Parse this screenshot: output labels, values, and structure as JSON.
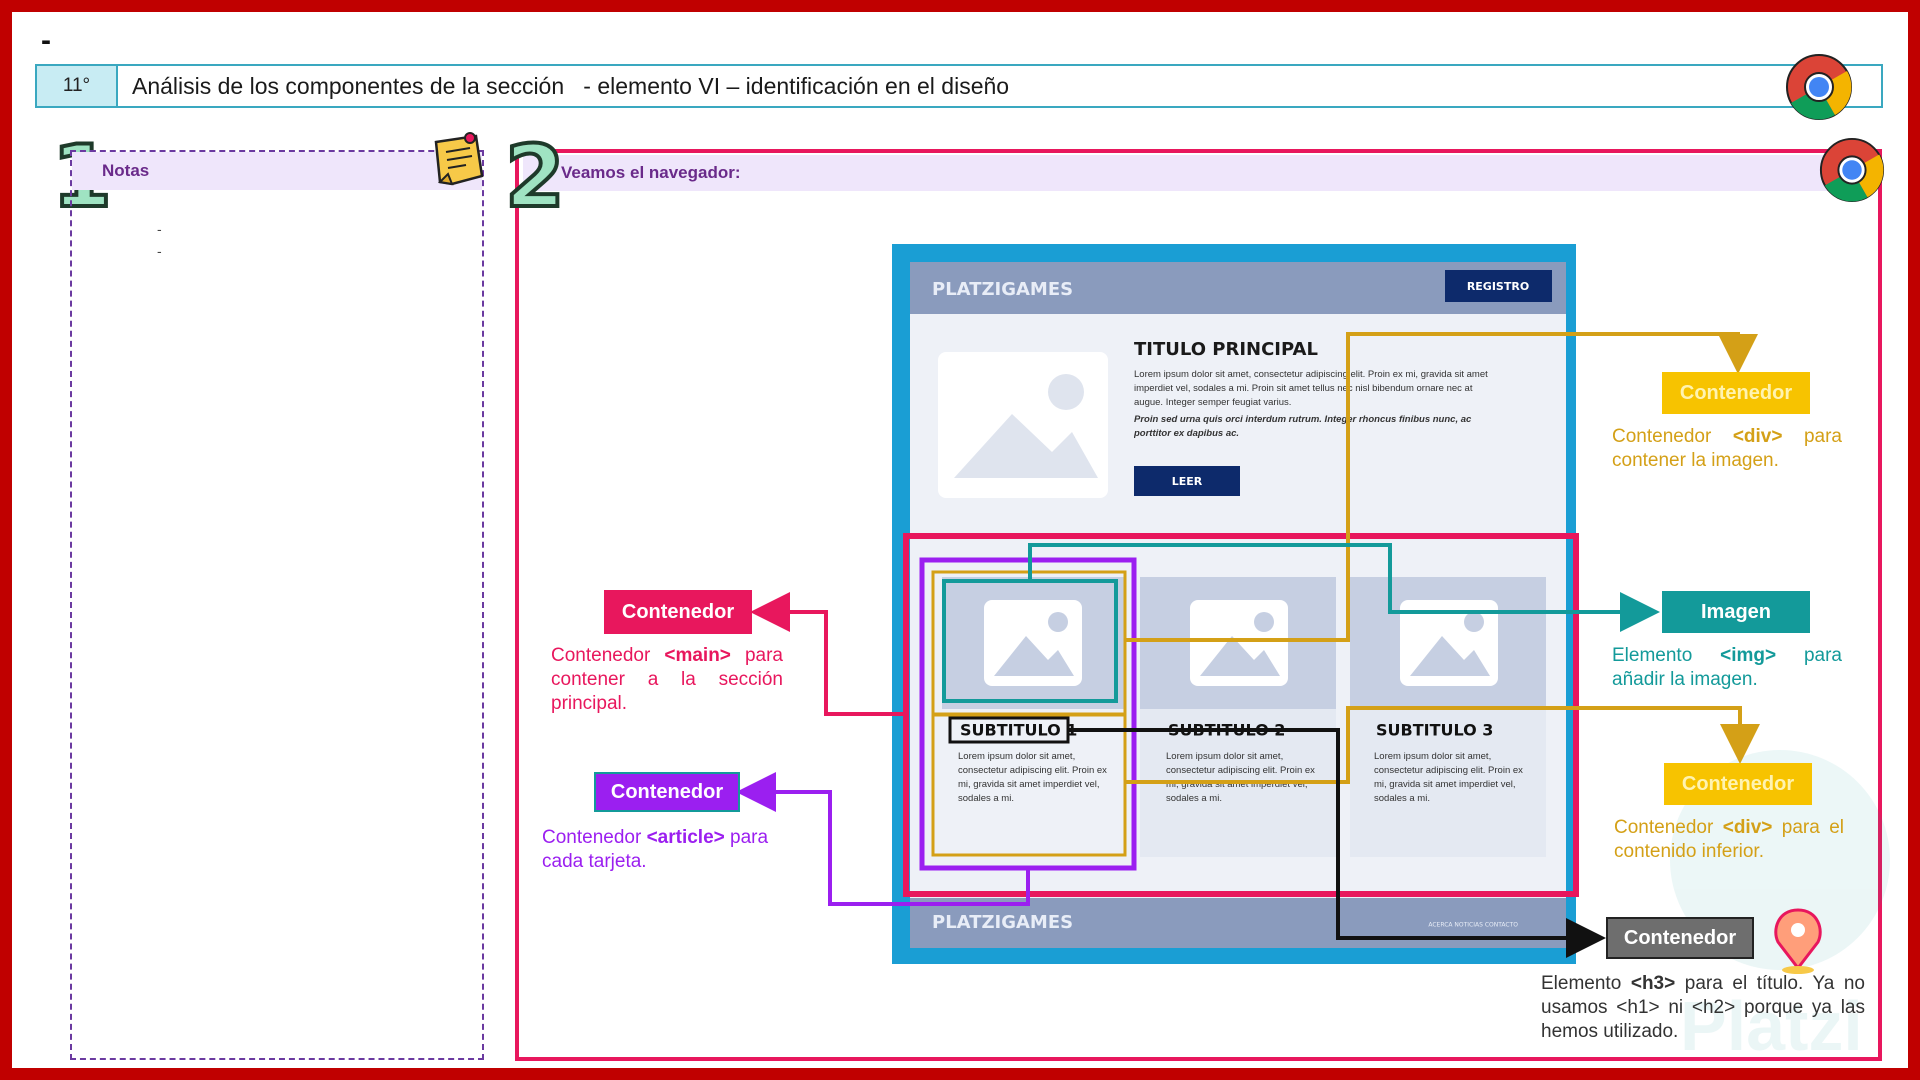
{
  "page": {
    "top_dash": "-",
    "slide_number": "11°",
    "slide_title": "Análisis de los componentes de la sección   - elemento VI – identificación en el diseño"
  },
  "notes_panel": {
    "number": "1",
    "title": "Notas",
    "items": [
      "-",
      "-"
    ]
  },
  "browser_panel": {
    "number": "2",
    "title": "Veamos el navegador:"
  },
  "mockup": {
    "brand": "PLATZIGAMES",
    "register_button": "REGISTRO",
    "main_title": "TITULO PRINCIPAL",
    "paragraph": "Lorem ipsum dolor sit amet, consectetur adipiscing elit. Proin ex mi, gravida sit amet imperdiet vel, sodales a mi. Proin sit amet tellus nec nisl bibendum ornare nec at augue. Integer semper feugiat varius.",
    "paragraph_italic": "Proin sed urna quis orci interdum rutrum. Integer rhoncus finibus nunc, ac porttitor ex dapibus ac.",
    "read_button": "LEER",
    "cards": [
      {
        "subtitle": "SUBTITULO 1",
        "text": "Lorem ipsum dolor sit amet, consectetur adipiscing elit. Proin ex mi, gravida sit amet imperdiet vel, sodales a mi."
      },
      {
        "subtitle": "SUBTITULO 2",
        "text": "Lorem ipsum dolor sit amet, consectetur adipiscing elit. Proin ex mi, gravida sit amet imperdiet vel, sodales a mi."
      },
      {
        "subtitle": "SUBTITULO 3",
        "text": "Lorem ipsum dolor sit amet, consectetur adipiscing elit. Proin ex mi, gravida sit amet imperdiet vel, sodales a mi."
      }
    ],
    "footer_brand": "PLATZIGAMES",
    "footer_links": "ACERCA  NOTICIAS  CONTACTO"
  },
  "callouts": {
    "main": {
      "label": "Contenedor",
      "desc_pre": "Contenedor ",
      "tag": "<main>",
      "desc_post": " para contener a la sección principal.",
      "color": "#e8175d"
    },
    "article": {
      "label": "Contenedor",
      "desc_pre": "Contenedor ",
      "tag": "<article>",
      "desc_post": " para cada tarjeta.",
      "color": "#9b1ff0"
    },
    "div_image": {
      "label": "Contenedor",
      "desc_pre": "Contenedor ",
      "tag": "<div>",
      "desc_post": " para contener la imagen.",
      "color": "#d4a017"
    },
    "img": {
      "label": "Imagen",
      "desc_pre": "Elemento ",
      "tag": "<img>",
      "desc_post": " para añadir la imagen.",
      "color": "#139a9a"
    },
    "div_content": {
      "label": "Contenedor",
      "desc_pre": "Contenedor ",
      "tag": "<div>",
      "desc_post": " para el contenido inferior.",
      "color": "#d4a017"
    },
    "h3": {
      "label": "Contenedor",
      "desc_pre": "Elemento ",
      "tag": "<h3>",
      "desc_post": " para el título. Ya no usamos <h1> ni <h2> porque ya las hemos utilizado.",
      "color": "#555555"
    }
  },
  "watermark": "Platzi",
  "colors": {
    "frame": "#c00000",
    "header_border": "#3aa8c0",
    "pink": "#e8175d",
    "purple": "#9b1ff0",
    "gold": "#d4a017",
    "teal": "#139a9a",
    "mockup_border": "#1a9ed4",
    "mockup_nav": "#8a9bbd",
    "navy": "#0d2a6b"
  }
}
